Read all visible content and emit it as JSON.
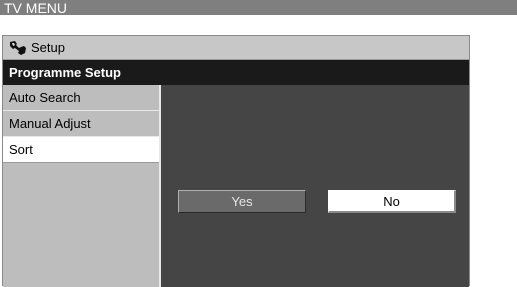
{
  "window": {
    "title": "TV MENU"
  },
  "menu": {
    "category_label": "Setup",
    "category_icon": "tool-icon",
    "section_title": "Programme Setup",
    "items": [
      {
        "label": "Auto Search",
        "selected": false
      },
      {
        "label": "Manual Adjust",
        "selected": false
      },
      {
        "label": "Sort",
        "selected": true
      }
    ]
  },
  "dialog": {
    "yes_label": "Yes",
    "no_label": "No",
    "focused": "No"
  },
  "colors": {
    "title_bar": "#7f7f7f",
    "section_header": "#1a1a1a",
    "content_bg": "#454545",
    "sidebar_bg": "#bdbdbd"
  }
}
